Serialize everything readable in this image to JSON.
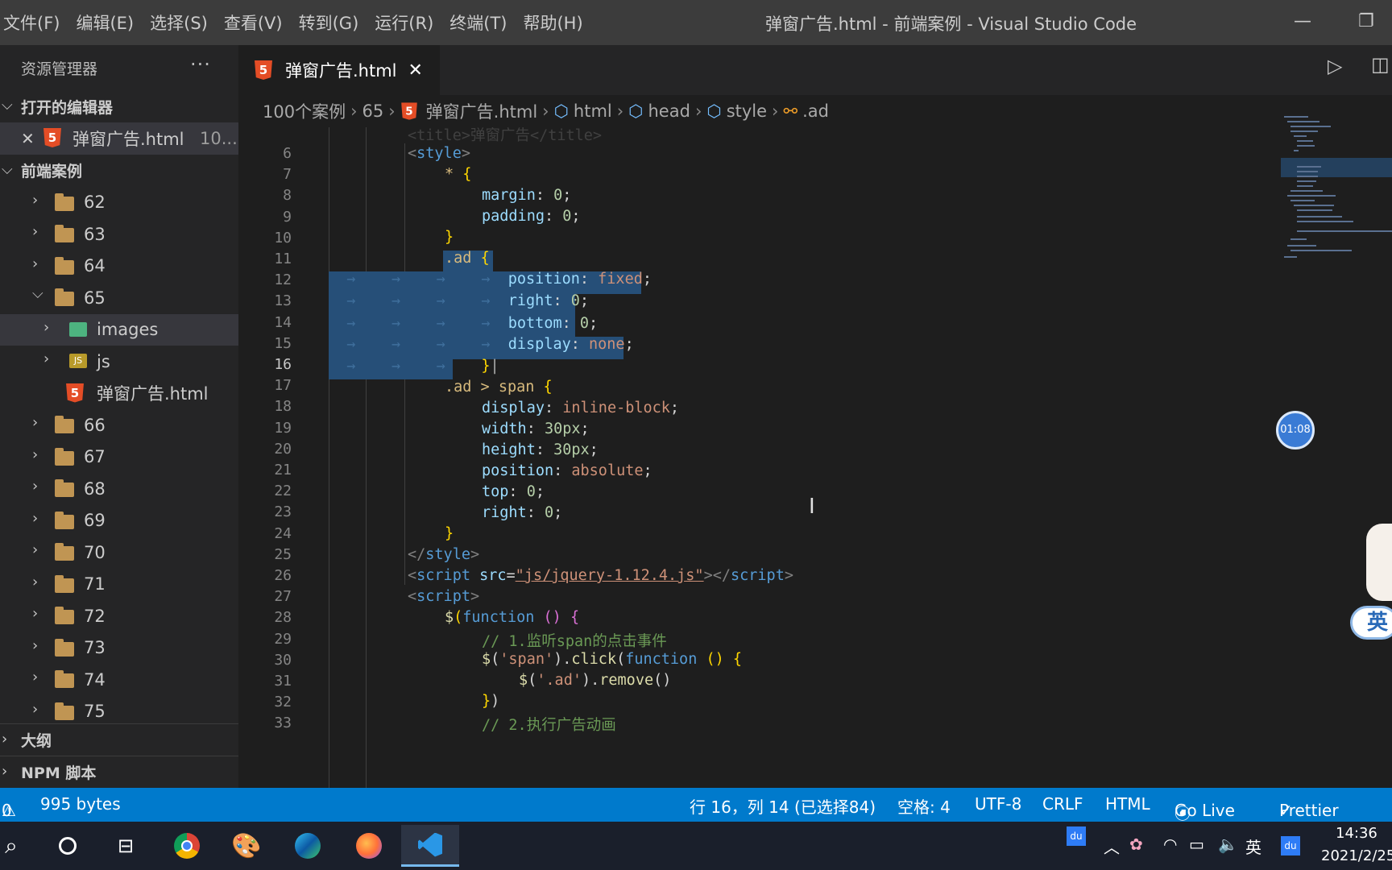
{
  "menu": [
    "文件(F)",
    "编辑(E)",
    "选择(S)",
    "查看(V)",
    "转到(G)",
    "运行(R)",
    "终端(T)",
    "帮助(H)"
  ],
  "window_title": "弹窗广告.html - 前端案例 - Visual Studio Code",
  "sidebar": {
    "header": "资源管理器",
    "open_editors_label": "打开的编辑器",
    "open_file": "弹窗广告.html",
    "open_file_path": "10...",
    "workspace_label": "前端案例",
    "tree": [
      {
        "label": "62",
        "kind": "folder"
      },
      {
        "label": "63",
        "kind": "folder"
      },
      {
        "label": "64",
        "kind": "folder"
      },
      {
        "label": "65",
        "kind": "folder-open"
      },
      {
        "label": "images",
        "kind": "images"
      },
      {
        "label": "js",
        "kind": "js"
      },
      {
        "label": "弹窗广告.html",
        "kind": "html"
      },
      {
        "label": "66",
        "kind": "folder"
      },
      {
        "label": "67",
        "kind": "folder"
      },
      {
        "label": "68",
        "kind": "folder"
      },
      {
        "label": "69",
        "kind": "folder"
      },
      {
        "label": "70",
        "kind": "folder"
      },
      {
        "label": "71",
        "kind": "folder"
      },
      {
        "label": "72",
        "kind": "folder"
      },
      {
        "label": "73",
        "kind": "folder"
      },
      {
        "label": "74",
        "kind": "folder"
      },
      {
        "label": "75",
        "kind": "folder"
      }
    ],
    "outline_label": "大纲",
    "npm_label": "NPM 脚本"
  },
  "tab": {
    "label": "弹窗广告.html"
  },
  "breadcrumbs": [
    "100个案例",
    "65",
    "弹窗广告.html",
    "html",
    "head",
    "style",
    ".ad"
  ],
  "code_lines": [
    6,
    7,
    8,
    9,
    10,
    11,
    12,
    13,
    14,
    15,
    16,
    17,
    18,
    19,
    20,
    21,
    22,
    23,
    24,
    25,
    26,
    27,
    28,
    29,
    30,
    31,
    32,
    33
  ],
  "current_line": 16,
  "timer": "01:08",
  "ime_label": "英",
  "status": {
    "errors": "0",
    "size": "995 bytes",
    "position": "行 16，列 14 (已选择84)",
    "spaces": "空格: 4",
    "encoding": "UTF-8",
    "eol": "CRLF",
    "language": "HTML",
    "golive": "Go Live",
    "prettier": "Prettier"
  },
  "taskbar": {
    "tray_lang": "英",
    "time": "14:36",
    "date": "2021/2/25"
  },
  "colors": {
    "accent": "#007acc",
    "selection": "#264f78"
  }
}
